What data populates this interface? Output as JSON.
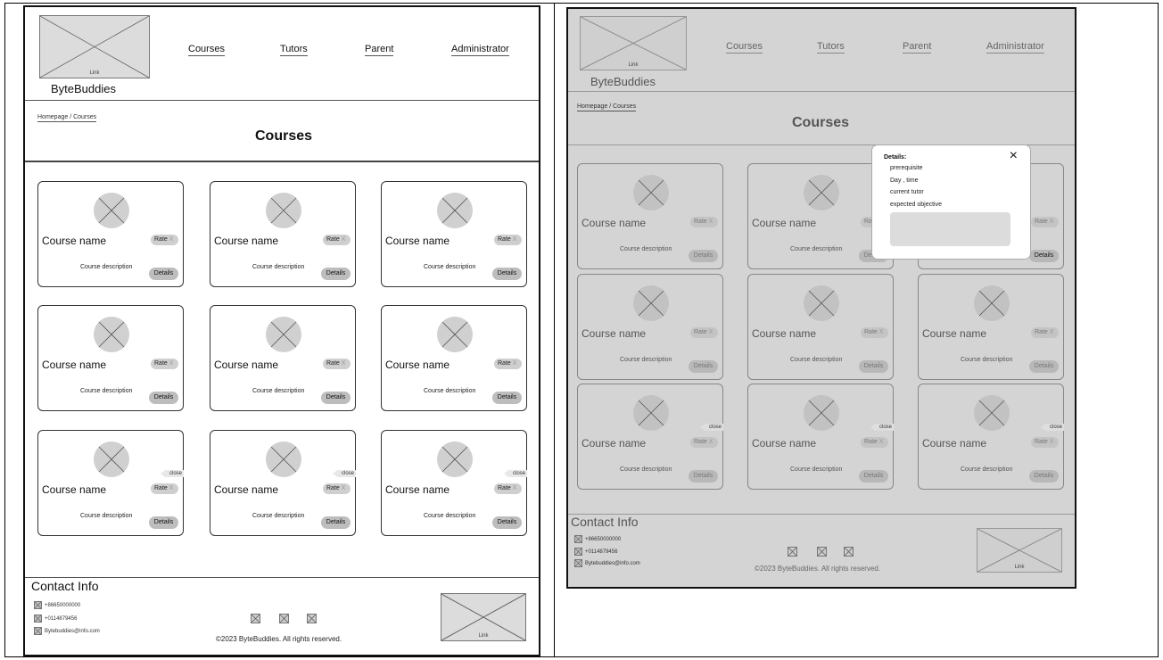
{
  "brand": "ByteBuddies",
  "logo_link": "Link",
  "nav": [
    "Courses",
    "Tutors",
    "Parent",
    "Administrator"
  ],
  "breadcrumb": "Homepage / Courses",
  "page_title": "Courses",
  "card": {
    "course_name": "Course name",
    "rate_label": "Rate",
    "rate_x": "X",
    "description": "Course description",
    "details_label": "Details",
    "close_label": "close"
  },
  "contact": {
    "title": "Contact Info",
    "phone1": "+86650000000",
    "phone2": "+0114879456",
    "email": "Bytebuddies@info.com"
  },
  "footer_link": "Link",
  "copyright": "©2023 ByteBuddies. All rights reserved.",
  "modal": {
    "title": "Details:",
    "items": [
      "prerequisite",
      "Day , time",
      "current tutor",
      "expected objective"
    ],
    "close_icon": "×"
  }
}
